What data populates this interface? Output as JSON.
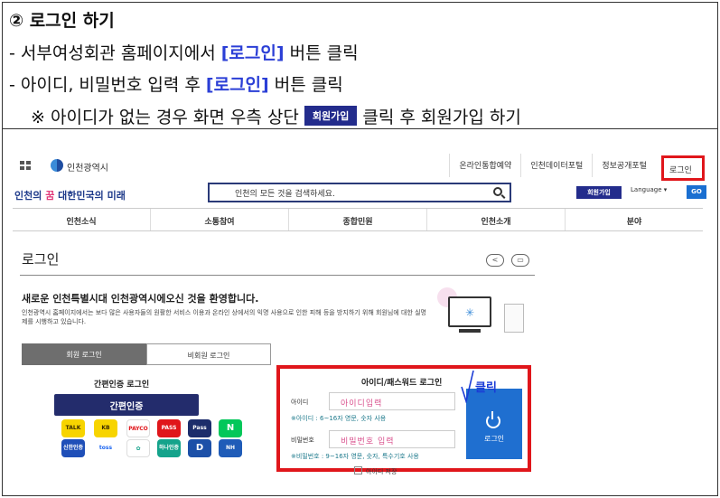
{
  "instructions": {
    "heading": "② 로그인 하기",
    "line2_pre": "- 서부여성회관 홈페이지에서 ",
    "line2_hl": "[로그인]",
    "line2_post": " 버튼 클릭",
    "line3_pre": "- 아이디, 비밀번호 입력 후 ",
    "line3_hl": "[로그인]",
    "line3_post": " 버튼 클릭",
    "line4_pre": "※ 아이디가 없는 경우 화면 우측 상단",
    "line4_chip": "회원가입",
    "line4_post": "클릭 후 회원가입 하기"
  },
  "topbar": {
    "gov_name": "인천광역시",
    "links": [
      "온라인통합예약",
      "인천데이터포털",
      "정보공개포털"
    ],
    "login": "로그인"
  },
  "header": {
    "brand_a": "인천의 ",
    "brand_b": "꿈",
    "brand_c": " 대한민국의 미래",
    "search_placeholder": "인천의 모든 것을 검색하세요.",
    "join": "회원가입",
    "language": "Language ▾",
    "go": "GO"
  },
  "nav": [
    "인천소식",
    "소통참여",
    "종합민원",
    "인천소개",
    "분야"
  ],
  "page": {
    "title": "로그인",
    "share_icon": "share-icon",
    "print_icon": "print-icon",
    "welcome": "새로운 인천특별시대 인천광역시에오신 것을 환영합니다.",
    "desc": "인천광역시 홈페이지에서는 보다 많은 사용자들의 원활한 서비스 이용과 온라인 상에서의 익명 사용으로 인한 피해 등을 방지하기 위해 회원님에 대한 실명제를 시행하고 있습니다.",
    "tab_member": "회원 로그인",
    "tab_guest": "비회원 로그인"
  },
  "easy": {
    "title": "간편인증 로그인",
    "button": "간편인증",
    "providers": [
      "TALK",
      "PAYCO",
      "PASS",
      "Pass",
      "N",
      "신한인증",
      "toss",
      "KB",
      "하나인증",
      "D",
      "NH"
    ]
  },
  "login_box": {
    "title": "아이디/패스워드 로그인",
    "id_label": "아이디",
    "id_placeholder": "아이디입력",
    "id_hint": "※아이디 : 6~16자 영문, 숫자 사용",
    "pw_label": "비밀번호",
    "pw_placeholder": "비밀번호 입력",
    "pw_hint": "※비밀번호 : 9~16자 영문, 숫자, 특수기호 사용",
    "login_button": "로그인",
    "save_id": "아이디 저장"
  },
  "annotation": {
    "click": "클릭"
  },
  "colors": {
    "highlight_red": "#e0161b",
    "accent_blue": "#2b3fd6",
    "navy": "#232c8c"
  }
}
